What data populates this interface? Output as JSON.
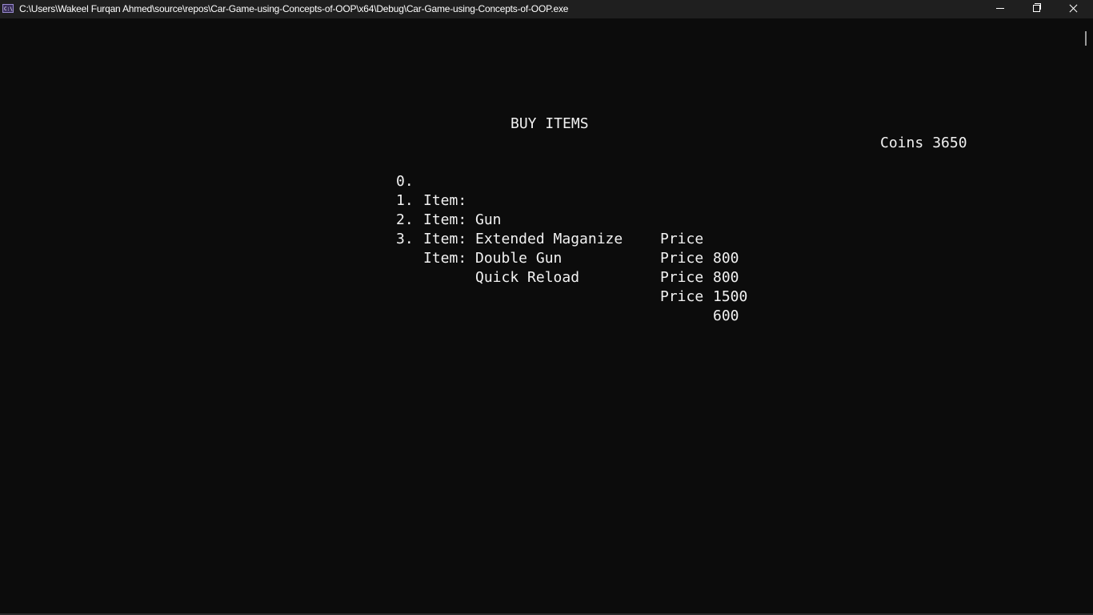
{
  "window": {
    "title": "C:\\Users\\Wakeel Furqan Ahmed\\source\\repos\\Car-Game-using-Concepts-of-OOP\\x64\\Debug\\Car-Game-using-Concepts-of-OOP.exe",
    "icon": "console-app-icon",
    "controls": [
      "minimize-icon",
      "restore-icon",
      "close-icon"
    ]
  },
  "screen": {
    "heading": "BUY ITEMS",
    "coins_label": "Coins",
    "coins_value": "3650",
    "items": [
      {
        "index": "0.",
        "item_label": "Item:",
        "name": "Gun",
        "price_label": "Price",
        "price": "800"
      },
      {
        "index": "1.",
        "item_label": "Item:",
        "name": "Extended Maganize",
        "price_label": "Price",
        "price": "800"
      },
      {
        "index": "2.",
        "item_label": "Item:",
        "name": "Double Gun",
        "price_label": "Price",
        "price": "1500"
      },
      {
        "index": "3.",
        "item_label": "Item:",
        "name": "Quick Reload",
        "price_label": "Price",
        "price": "600"
      }
    ]
  },
  "colors": {
    "background": "#0c0c0c",
    "titlebar": "#1f1f1f",
    "text": "#f2f2f2"
  }
}
